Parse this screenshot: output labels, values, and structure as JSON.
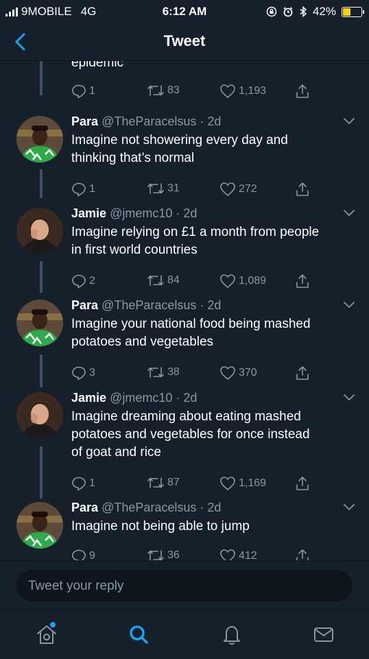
{
  "status_bar": {
    "carrier": "9MOBILE",
    "network": "4G",
    "time": "6:12 AM",
    "battery": "42%"
  },
  "nav": {
    "title": "Tweet"
  },
  "previous_tweet": {
    "cut_text": "epidemic",
    "replies": "1",
    "retweets": "83",
    "likes": "1,193"
  },
  "tweets": [
    {
      "name": "Para",
      "handle": "@TheParacelsus",
      "time": "· 2d",
      "line1": "Imagine not showering every day and",
      "line2": "thinking that’s normal",
      "line3": "",
      "replies": "1",
      "retweets": "31",
      "likes": "272"
    },
    {
      "name": "Jamie",
      "handle": "@jmemc10",
      "time": "· 2d",
      "line1": "Imagine relying on £1 a month from people",
      "line2": "in first world countries",
      "line3": "",
      "replies": "2",
      "retweets": "84",
      "likes": "1,089"
    },
    {
      "name": "Para",
      "handle": "@TheParacelsus",
      "time": "· 2d",
      "line1": "Imagine your national food being mashed",
      "line2": "potatoes and vegetables",
      "line3": "",
      "replies": "3",
      "retweets": "38",
      "likes": "370"
    },
    {
      "name": "Jamie",
      "handle": "@jmemc10",
      "time": "· 2d",
      "line1": "Imagine dreaming about eating mashed",
      "line2": "potatoes and vegetables for once instead",
      "line3": "of goat and rice",
      "replies": "1",
      "retweets": "87",
      "likes": "1,169"
    },
    {
      "name": "Para",
      "handle": "@TheParacelsus",
      "time": "· 2d",
      "line1": "Imagine not being able to jump",
      "line2": "",
      "line3": "",
      "replies": "9",
      "retweets": "36",
      "likes": "412"
    }
  ],
  "reply": {
    "placeholder": "Tweet your reply"
  },
  "colors": {
    "background": "#15202b",
    "secondary_text": "#8899a6",
    "accent": "#1da1f2",
    "battery": "#f5d400"
  },
  "tabbar": {
    "items": [
      "home-icon",
      "search-icon",
      "notifications-icon",
      "messages-icon"
    ],
    "active": "search-icon"
  }
}
